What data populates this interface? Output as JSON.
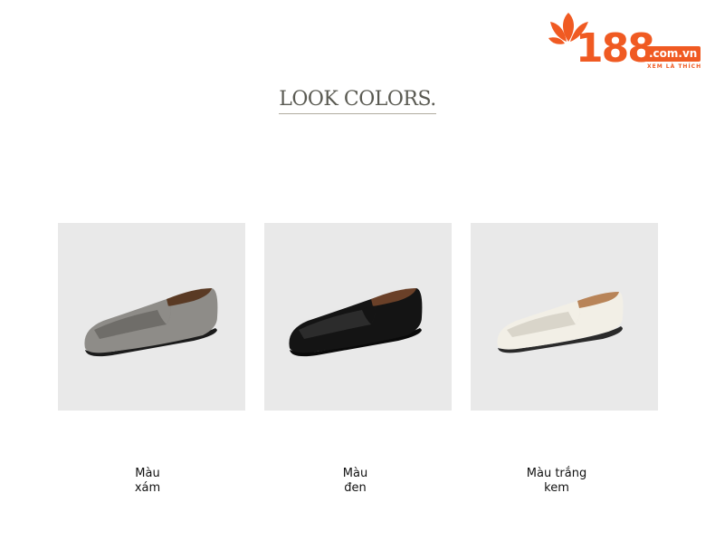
{
  "brand": {
    "logo_number": "188",
    "logo_domain": ".com.vn",
    "logo_slogan": "XEM LÀ THÍCH",
    "color": "#f05a22"
  },
  "heading": {
    "title": "LOOK COLORS."
  },
  "products": [
    {
      "label_line1": "Màu",
      "label_line2": "xám",
      "upper_color": "#8e8c88",
      "shade_color": "#6f6d69",
      "sole_color": "#1b1b1b"
    },
    {
      "label_line1": "Màu",
      "label_line2": "đen",
      "upper_color": "#141414",
      "shade_color": "#2c2c2c",
      "sole_color": "#0a0a0a"
    },
    {
      "label_line1": "Màu trắng",
      "label_line2": "kem",
      "upper_color": "#f2efe6",
      "shade_color": "#d9d5ca",
      "sole_color": "#2a2a2a"
    }
  ]
}
